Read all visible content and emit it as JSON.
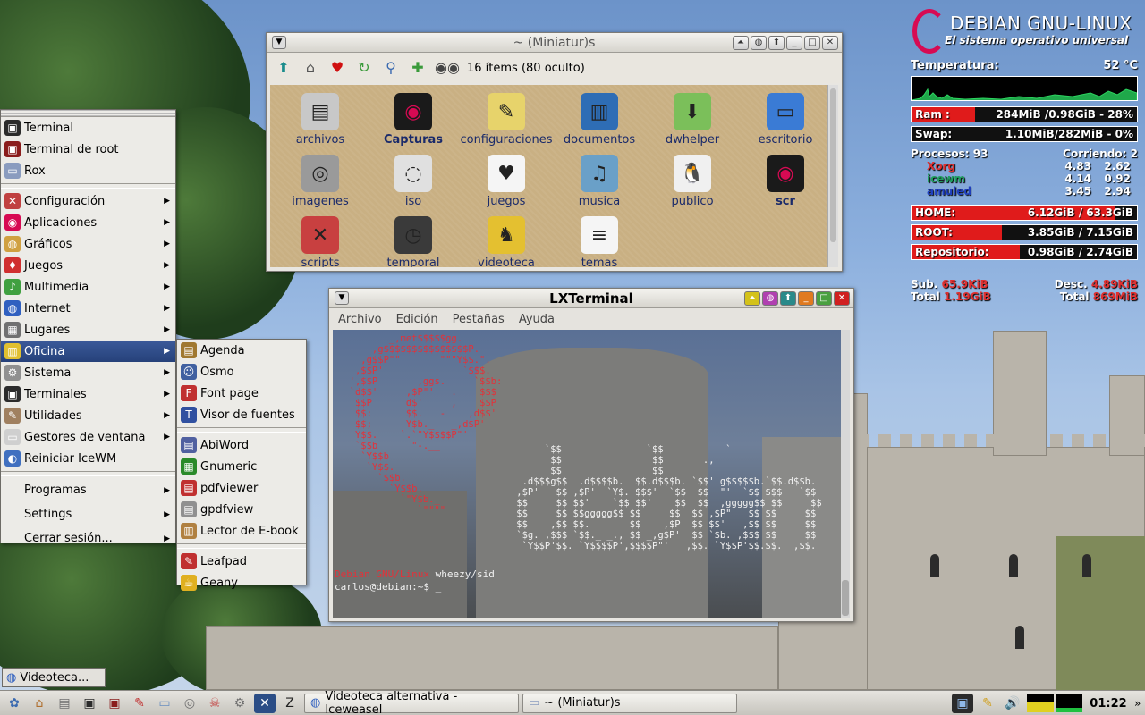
{
  "conky": {
    "title": "DEBIAN GNU-LINUX",
    "subtitle": "El sistema operativo universal",
    "temp_label": "Temperatura:",
    "temp_value": "52 °C",
    "ram": {
      "label": "Ram :",
      "value": "284MiB /0.98GiB - 28%",
      "percent": 28
    },
    "swap": {
      "label": "Swap:",
      "value": "1.10MiB/282MiB - 0%",
      "percent": 0
    },
    "procs_label": "Procesos: 93",
    "running_label": "Corriendo: 2",
    "procs": [
      {
        "name": "Xorg",
        "a": "4.83",
        "b": "2.62",
        "color": "#e03030"
      },
      {
        "name": "icewm",
        "a": "4.14",
        "b": "0.92",
        "color": "#20a060"
      },
      {
        "name": "amuled",
        "a": "3.45",
        "b": "2.94",
        "color": "#2040c0"
      }
    ],
    "home": {
      "label": "HOME:",
      "value": "6.12GiB / 63.3GiB",
      "percent": 90
    },
    "root": {
      "label": "ROOT:",
      "value": "3.85GiB / 7.15GiB",
      "percent": 40
    },
    "repo": {
      "label": "Repositorio:",
      "value": "0.98GiB / 2.74GiB",
      "percent": 48
    },
    "sub_label": "Sub.",
    "sub_value": "65.9KiB",
    "total_label": "Total",
    "total_up": "1.19GiB",
    "desc_label": "Desc.",
    "desc_value": "4.89KiB",
    "total_down": "869MiB"
  },
  "filemanager": {
    "title": "~ (Miniatur)s",
    "status": "16 ítems (80 oculto)",
    "items": [
      {
        "label": "archivos",
        "icon": "drive-icon",
        "color": "#c8c8c8",
        "glyph": "▤",
        "bold": false
      },
      {
        "label": "Capturas",
        "icon": "folder-debian-icon",
        "color": "#1a1a1a",
        "glyph": "◉",
        "bold": true
      },
      {
        "label": "configuraciones",
        "icon": "notes-icon",
        "color": "#e7d36b",
        "glyph": "✎",
        "bold": false
      },
      {
        "label": "documentos",
        "icon": "books-icon",
        "color": "#2e6db5",
        "glyph": "▥",
        "bold": false
      },
      {
        "label": "dwhelper",
        "icon": "download-icon",
        "color": "#7bbf5a",
        "glyph": "⬇",
        "bold": false
      },
      {
        "label": "escritorio",
        "icon": "desktop-icon",
        "color": "#3a7bd5",
        "glyph": "▭",
        "bold": false
      },
      {
        "label": "imagenes",
        "icon": "camera-icon",
        "color": "#9a9a9a",
        "glyph": "◎",
        "bold": false
      },
      {
        "label": "iso",
        "icon": "disc-icon",
        "color": "#e0e0e0",
        "glyph": "◌",
        "bold": false
      },
      {
        "label": "juegos",
        "icon": "cards-icon",
        "color": "#f5f5f5",
        "glyph": "♥",
        "bold": false
      },
      {
        "label": "musica",
        "icon": "music-icon",
        "color": "#6aa0c8",
        "glyph": "♫",
        "bold": false
      },
      {
        "label": "publico",
        "icon": "tux-icon",
        "color": "#f0f0f0",
        "glyph": "🐧",
        "bold": false
      },
      {
        "label": "scr",
        "icon": "folder-debian-icon",
        "color": "#1a1a1a",
        "glyph": "◉",
        "bold": true
      },
      {
        "label": "scripts",
        "icon": "tools-icon",
        "color": "#c84040",
        "glyph": "✕",
        "bold": false
      },
      {
        "label": "temporal",
        "icon": "clock-icon",
        "color": "#3a3a3a",
        "glyph": "◷",
        "bold": false
      },
      {
        "label": "videoteca",
        "icon": "gnu-icon",
        "color": "#e4c030",
        "glyph": "♞",
        "bold": false
      },
      {
        "label": "temas",
        "icon": "document-icon",
        "color": "#f5f5f5",
        "glyph": "≡",
        "bold": false
      }
    ]
  },
  "terminal": {
    "title": "LXTerminal",
    "menu": [
      "Archivo",
      "Edición",
      "Pestañas",
      "Ayuda"
    ],
    "os_name": "Debian GNU/Linux",
    "os_version": "wheezy/sid",
    "prompt": "carlos@debian:~$ _",
    "ascii_red": "         _,met$$$$$gg.\n      ,g$$$$$$$$$$$$$$$P.\n    ,g$$P\"\"       \"\"\"Y$$.\".\n   ,$$P'              `$$$.\n  ',$$P       ,ggs.     `$$b:\n  `d$$'     ,$P\"'   .    $$$\n   $$P      d$'     ,    $$P\n   $$:      $$.   -    ,d$$'\n   $$;      Y$b._   _,d$P'\n   Y$$.    `.`\"Y$$$$P\"'\n   `$$b      \"-.__\n    `Y$$b\n     `Y$$.\n       `$$b.\n         `Y$$b.\n           `\"Y$b._\n              `\"\"\"\"",
    "ascii_white": "         `$$               `$$           `\n          $$                $$       .,\n          $$                $$\n     .d$$$g$$  .d$$$$b.  $$.d$$$b. `$$' g$$$$$b.`$$.d$$b.\n    ,$P'   $$ ,$P'  `Y$. $$$'  `$$  $$  \"'  `$$ $$$'  `$$\n    $$     $$ $$'    `$$ $$'    $$  $$  ,ggggg$$ $$'    $$\n    $$     $$ $$ggggg$$ $$     $$  $$ ,$P\"   $$ $$     $$\n    $$    ,$$ $$.       $$    ,$P  $$ $$'   ,$$ $$     $$\n    `$g. ,$$$ `$$._ _., $$ _,g$P'  $$ `$b. ,$$$ $$     $$\n     `Y$$P'$$. `Y$$$$P',$$$$P\"'   ,$$. `Y$$P'$$.$$.  ,$$."
  },
  "startmenu": {
    "top": [
      {
        "label": "Terminal",
        "icon": "terminal-icon",
        "color": "#2b2b2b",
        "glyph": "▣"
      },
      {
        "label": "Terminal de root",
        "icon": "root-terminal-icon",
        "color": "#8a1c1c",
        "glyph": "▣"
      },
      {
        "label": "Rox",
        "icon": "rox-icon",
        "color": "#8a9cbf",
        "glyph": "▭"
      }
    ],
    "main": [
      {
        "label": "Configuración",
        "icon": "config-icon",
        "color": "#c04040",
        "glyph": "✕",
        "sub": true
      },
      {
        "label": "Aplicaciones",
        "icon": "debian-icon",
        "color": "#d70a53",
        "glyph": "◉",
        "sub": true
      },
      {
        "label": "Gráficos",
        "icon": "graphics-icon",
        "color": "#d0a040",
        "glyph": "◍",
        "sub": true
      },
      {
        "label": "Juegos",
        "icon": "games-icon",
        "color": "#d03030",
        "glyph": "♦",
        "sub": true
      },
      {
        "label": "Multimedia",
        "icon": "multimedia-icon",
        "color": "#40a040",
        "glyph": "♪",
        "sub": true
      },
      {
        "label": "Internet",
        "icon": "globe-icon",
        "color": "#3060c0",
        "glyph": "◍",
        "sub": true
      },
      {
        "label": "Lugares",
        "icon": "places-icon",
        "color": "#707070",
        "glyph": "▦",
        "sub": true
      },
      {
        "label": "Oficina",
        "icon": "office-icon",
        "color": "#e0c030",
        "glyph": "▥",
        "sub": true,
        "active": true
      },
      {
        "label": "Sistema",
        "icon": "system-icon",
        "color": "#909090",
        "glyph": "⚙",
        "sub": true
      },
      {
        "label": "Terminales",
        "icon": "terminals-icon",
        "color": "#2b2b2b",
        "glyph": "▣",
        "sub": true
      },
      {
        "label": "Utilidades",
        "icon": "utilities-icon",
        "color": "#a08060",
        "glyph": "✎",
        "sub": true
      },
      {
        "label": "Gestores de ventana",
        "icon": "windows-icon",
        "color": "#cfcfcf",
        "glyph": "▭",
        "sub": true
      },
      {
        "label": "Reiniciar IceWM",
        "icon": "icewm-icon",
        "color": "#4070c0",
        "glyph": "◐",
        "sub": false
      }
    ],
    "bottom": [
      {
        "label": "Programas",
        "sub": true
      },
      {
        "label": "Settings",
        "sub": true
      },
      {
        "label": "Cerrar sesión...",
        "sub": true
      }
    ]
  },
  "submenu": {
    "group1": [
      {
        "label": "Agenda",
        "icon": "agenda-icon",
        "color": "#a07830",
        "glyph": "▤"
      },
      {
        "label": "Osmo",
        "icon": "osmo-icon",
        "color": "#4060a0",
        "glyph": "☺"
      },
      {
        "label": "Font page",
        "icon": "font-icon",
        "color": "#c03030",
        "glyph": "F"
      },
      {
        "label": "Visor de fuentes",
        "icon": "font-viewer-icon",
        "color": "#3050a0",
        "glyph": "T"
      }
    ],
    "group2": [
      {
        "label": "AbiWord",
        "icon": "abiword-icon",
        "color": "#5060a0",
        "glyph": "▤"
      },
      {
        "label": "Gnumeric",
        "icon": "gnumeric-icon",
        "color": "#2a8a2a",
        "glyph": "▦"
      },
      {
        "label": "pdfviewer",
        "icon": "pdf-icon",
        "color": "#c03030",
        "glyph": "▤"
      },
      {
        "label": "gpdfview",
        "icon": "gpdfview-icon",
        "color": "#909090",
        "glyph": "▤"
      },
      {
        "label": "Lector de E-book",
        "icon": "ebook-icon",
        "color": "#b08040",
        "glyph": "▥"
      }
    ],
    "group3": [
      {
        "label": "Leafpad",
        "icon": "leafpad-icon",
        "color": "#c03030",
        "glyph": "✎"
      },
      {
        "label": "Geany",
        "icon": "geany-icon",
        "color": "#e0b020",
        "glyph": "☕"
      }
    ]
  },
  "taskbar": {
    "mini_task": "Videoteca...",
    "quick": [
      {
        "icon": "menu-icon",
        "glyph": "✿",
        "color": "#3a6ab0"
      },
      {
        "icon": "home-icon",
        "glyph": "⌂",
        "color": "#b07030"
      },
      {
        "icon": "window-list-icon",
        "glyph": "▤",
        "color": "#707070"
      },
      {
        "icon": "terminal-icon",
        "glyph": "▣",
        "color": "#2b2b2b"
      },
      {
        "icon": "root-terminal-icon",
        "glyph": "▣",
        "color": "#8a1c1c"
      },
      {
        "icon": "editor-icon",
        "glyph": "✎",
        "color": "#c03030"
      },
      {
        "icon": "filemanager-icon",
        "glyph": "▭",
        "color": "#6a8fc0"
      },
      {
        "icon": "image-viewer-icon",
        "glyph": "◎",
        "color": "#707070"
      },
      {
        "icon": "skull-icon",
        "glyph": "☠",
        "color": "#c03030"
      },
      {
        "icon": "settings-icon",
        "glyph": "⚙",
        "color": "#707070"
      },
      {
        "icon": "close-all-icon",
        "glyph": "✕",
        "color": "#2b4d86"
      },
      {
        "icon": "z-icon",
        "glyph": "Z",
        "color": "#e6e4df"
      }
    ],
    "tasks": [
      {
        "label": "Videoteca alternativa - Iceweasel",
        "icon": "browser-icon",
        "glyph": "◍",
        "color": "#3060c0"
      },
      {
        "label": "~ (Miniatur)s",
        "icon": "folder-icon",
        "glyph": "▭",
        "color": "#8a9cbf"
      }
    ],
    "clock": "01:22"
  }
}
